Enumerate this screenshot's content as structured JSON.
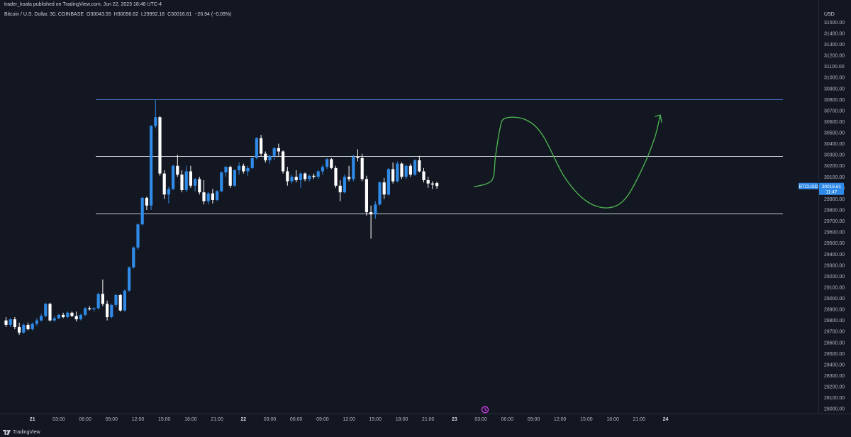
{
  "header": {
    "published": "trader_koala published on TradingView.com, Jun 22, 2023 18:48 UTC-4",
    "symbol_line": "Bitcoin / U.S. Dollar, 30, COINBASE",
    "ohlc": [
      {
        "label": "O",
        "value": "30043.55"
      },
      {
        "label": "H",
        "value": "30056.62"
      },
      {
        "label": "L",
        "value": "29992.18"
      },
      {
        "label": "C",
        "value": "30016.61"
      }
    ],
    "change": "−26.94 (−0.09%)"
  },
  "footer": {
    "brand": "TradingView",
    "logo_icon": "tradingview-logo-icon"
  },
  "colors": {
    "background": "#131722",
    "up": "#2962ff",
    "up_light": "#2f8ae8",
    "down": "#ffffff",
    "level_line": "#c9ccd4",
    "top_line": "#4a76c7",
    "projection": "#4caf50",
    "price_tag": "#2f8ae8",
    "axis_text": "#b2b5be"
  },
  "chart_data": {
    "type": "candlestick",
    "symbol": "BTCUSD",
    "interval": "30",
    "exchange": "COINBASE",
    "price_axis": {
      "currency": "USD",
      "ylim": [
        27950,
        31650
      ],
      "ticks": [
        28000,
        28100,
        28200,
        28300,
        28400,
        28500,
        28600,
        28700,
        28800,
        28900,
        29000,
        29100,
        29200,
        29300,
        29400,
        29500,
        29600,
        29700,
        29800,
        29900,
        30000,
        30100,
        30200,
        30300,
        30400,
        30500,
        30600,
        30700,
        30800,
        30900,
        31000,
        31100,
        31200,
        31300,
        31400,
        31500
      ]
    },
    "time_axis": {
      "labels": [
        "21",
        "03:00",
        "06:00",
        "09:00",
        "12:00",
        "15:00",
        "18:00",
        "21:00",
        "22",
        "03:00",
        "06:00",
        "09:00",
        "12:00",
        "15:00",
        "18:00",
        "21:00",
        "23",
        "03:00",
        "06:00",
        "09:00",
        "12:00",
        "15:00",
        "18:00",
        "21:00",
        "24"
      ],
      "bold": [
        "21",
        "22",
        "23",
        "24"
      ],
      "bars_per_label": 6
    },
    "last_price": {
      "symbol": "BTCUSD",
      "value": "30016.61",
      "countdown": "11:47"
    },
    "horizontal_levels": [
      {
        "price": 30800,
        "style": "blue"
      },
      {
        "price": 30290,
        "style": "light"
      },
      {
        "price": 29770,
        "style": "light"
      }
    ],
    "projection_path": [
      {
        "bar": 106.5,
        "price": 30010
      },
      {
        "bar": 110.5,
        "price": 30070
      },
      {
        "bar": 111.3,
        "price": 30280
      },
      {
        "bar": 112.3,
        "price": 30530
      },
      {
        "bar": 113.5,
        "price": 30630
      },
      {
        "bar": 118,
        "price": 30620
      },
      {
        "bar": 122,
        "price": 30480
      },
      {
        "bar": 127,
        "price": 30100
      },
      {
        "bar": 132,
        "price": 29880
      },
      {
        "bar": 137,
        "price": 29820
      },
      {
        "bar": 141,
        "price": 29910
      },
      {
        "bar": 145,
        "price": 30200
      },
      {
        "bar": 147.5,
        "price": 30450
      },
      {
        "bar": 148.8,
        "price": 30660
      }
    ],
    "candles": [
      {
        "o": 28800,
        "h": 28830,
        "l": 28740,
        "c": 28760
      },
      {
        "o": 28760,
        "h": 28820,
        "l": 28740,
        "c": 28810
      },
      {
        "o": 28810,
        "h": 28830,
        "l": 28720,
        "c": 28740
      },
      {
        "o": 28740,
        "h": 28780,
        "l": 28670,
        "c": 28690
      },
      {
        "o": 28690,
        "h": 28770,
        "l": 28680,
        "c": 28760
      },
      {
        "o": 28760,
        "h": 28780,
        "l": 28710,
        "c": 28720
      },
      {
        "o": 28720,
        "h": 28780,
        "l": 28710,
        "c": 28770
      },
      {
        "o": 28770,
        "h": 28820,
        "l": 28750,
        "c": 28800
      },
      {
        "o": 28800,
        "h": 28860,
        "l": 28790,
        "c": 28840
      },
      {
        "o": 28840,
        "h": 28960,
        "l": 28830,
        "c": 28950
      },
      {
        "o": 28950,
        "h": 28960,
        "l": 28790,
        "c": 28800
      },
      {
        "o": 28800,
        "h": 28840,
        "l": 28790,
        "c": 28820
      },
      {
        "o": 28820,
        "h": 28860,
        "l": 28810,
        "c": 28850
      },
      {
        "o": 28850,
        "h": 28870,
        "l": 28820,
        "c": 28830
      },
      {
        "o": 28830,
        "h": 28880,
        "l": 28820,
        "c": 28870
      },
      {
        "o": 28870,
        "h": 28880,
        "l": 28830,
        "c": 28840
      },
      {
        "o": 28840,
        "h": 28880,
        "l": 28790,
        "c": 28810
      },
      {
        "o": 28810,
        "h": 28860,
        "l": 28800,
        "c": 28850
      },
      {
        "o": 28850,
        "h": 28920,
        "l": 28840,
        "c": 28910
      },
      {
        "o": 28910,
        "h": 28930,
        "l": 28890,
        "c": 28900
      },
      {
        "o": 28900,
        "h": 28920,
        "l": 28880,
        "c": 28910
      },
      {
        "o": 28910,
        "h": 29050,
        "l": 28900,
        "c": 29040
      },
      {
        "o": 29040,
        "h": 29170,
        "l": 28930,
        "c": 28950
      },
      {
        "o": 28950,
        "h": 28980,
        "l": 28800,
        "c": 28830
      },
      {
        "o": 28830,
        "h": 28950,
        "l": 28820,
        "c": 28940
      },
      {
        "o": 28940,
        "h": 29040,
        "l": 28920,
        "c": 29030
      },
      {
        "o": 29030,
        "h": 29040,
        "l": 28880,
        "c": 28890
      },
      {
        "o": 28890,
        "h": 29080,
        "l": 28880,
        "c": 29070
      },
      {
        "o": 29070,
        "h": 29290,
        "l": 29060,
        "c": 29280
      },
      {
        "o": 29280,
        "h": 29470,
        "l": 29270,
        "c": 29460
      },
      {
        "o": 29460,
        "h": 29680,
        "l": 29440,
        "c": 29670
      },
      {
        "o": 29670,
        "h": 29920,
        "l": 29660,
        "c": 29910
      },
      {
        "o": 29910,
        "h": 29920,
        "l": 29800,
        "c": 29840
      },
      {
        "o": 29840,
        "h": 30570,
        "l": 29800,
        "c": 30560
      },
      {
        "o": 30560,
        "h": 30800,
        "l": 30540,
        "c": 30640
      },
      {
        "o": 30640,
        "h": 30650,
        "l": 30110,
        "c": 30130
      },
      {
        "o": 30130,
        "h": 30160,
        "l": 29900,
        "c": 29940
      },
      {
        "o": 29940,
        "h": 30010,
        "l": 29860,
        "c": 29990
      },
      {
        "o": 29990,
        "h": 30210,
        "l": 29980,
        "c": 30200
      },
      {
        "o": 30200,
        "h": 30300,
        "l": 30100,
        "c": 30120
      },
      {
        "o": 30120,
        "h": 30160,
        "l": 29960,
        "c": 29980
      },
      {
        "o": 29980,
        "h": 30200,
        "l": 29960,
        "c": 30150
      },
      {
        "o": 30150,
        "h": 30200,
        "l": 30000,
        "c": 30020
      },
      {
        "o": 30020,
        "h": 30090,
        "l": 29970,
        "c": 30080
      },
      {
        "o": 30080,
        "h": 30100,
        "l": 29940,
        "c": 29960
      },
      {
        "o": 29960,
        "h": 30070,
        "l": 29850,
        "c": 29880
      },
      {
        "o": 29880,
        "h": 29960,
        "l": 29850,
        "c": 29950
      },
      {
        "o": 29950,
        "h": 29990,
        "l": 29860,
        "c": 29890
      },
      {
        "o": 29890,
        "h": 29980,
        "l": 29880,
        "c": 29970
      },
      {
        "o": 29970,
        "h": 30150,
        "l": 29960,
        "c": 30140
      },
      {
        "o": 30140,
        "h": 30200,
        "l": 30100,
        "c": 30190
      },
      {
        "o": 30190,
        "h": 30200,
        "l": 30000,
        "c": 30020
      },
      {
        "o": 30020,
        "h": 30170,
        "l": 30010,
        "c": 30160
      },
      {
        "o": 30160,
        "h": 30230,
        "l": 30120,
        "c": 30200
      },
      {
        "o": 30200,
        "h": 30220,
        "l": 30130,
        "c": 30150
      },
      {
        "o": 30150,
        "h": 30200,
        "l": 30110,
        "c": 30180
      },
      {
        "o": 30180,
        "h": 30280,
        "l": 30170,
        "c": 30270
      },
      {
        "o": 30270,
        "h": 30460,
        "l": 30260,
        "c": 30450
      },
      {
        "o": 30450,
        "h": 30480,
        "l": 30290,
        "c": 30310
      },
      {
        "o": 30310,
        "h": 30330,
        "l": 30230,
        "c": 30250
      },
      {
        "o": 30250,
        "h": 30300,
        "l": 30220,
        "c": 30290
      },
      {
        "o": 30290,
        "h": 30370,
        "l": 30250,
        "c": 30360
      },
      {
        "o": 30360,
        "h": 30400,
        "l": 30290,
        "c": 30330
      },
      {
        "o": 30330,
        "h": 30340,
        "l": 30130,
        "c": 30150
      },
      {
        "o": 30150,
        "h": 30190,
        "l": 30020,
        "c": 30060
      },
      {
        "o": 30060,
        "h": 30120,
        "l": 30040,
        "c": 30100
      },
      {
        "o": 30100,
        "h": 30160,
        "l": 30050,
        "c": 30070
      },
      {
        "o": 30070,
        "h": 30140,
        "l": 30000,
        "c": 30130
      },
      {
        "o": 30130,
        "h": 30140,
        "l": 30060,
        "c": 30080
      },
      {
        "o": 30080,
        "h": 30120,
        "l": 30060,
        "c": 30110
      },
      {
        "o": 30110,
        "h": 30130,
        "l": 30080,
        "c": 30100
      },
      {
        "o": 30100,
        "h": 30160,
        "l": 30080,
        "c": 30150
      },
      {
        "o": 30150,
        "h": 30210,
        "l": 30120,
        "c": 30190
      },
      {
        "o": 30190,
        "h": 30270,
        "l": 30170,
        "c": 30260
      },
      {
        "o": 30260,
        "h": 30270,
        "l": 30170,
        "c": 30180
      },
      {
        "o": 30180,
        "h": 30200,
        "l": 30000,
        "c": 30020
      },
      {
        "o": 30020,
        "h": 30070,
        "l": 29880,
        "c": 29960
      },
      {
        "o": 29960,
        "h": 30120,
        "l": 29950,
        "c": 30100
      },
      {
        "o": 30100,
        "h": 30200,
        "l": 30060,
        "c": 30080
      },
      {
        "o": 30080,
        "h": 30300,
        "l": 30060,
        "c": 30280
      },
      {
        "o": 30280,
        "h": 30350,
        "l": 30240,
        "c": 30270
      },
      {
        "o": 30270,
        "h": 30310,
        "l": 30060,
        "c": 30080
      },
      {
        "o": 30080,
        "h": 30110,
        "l": 29750,
        "c": 29780
      },
      {
        "o": 29780,
        "h": 29840,
        "l": 29540,
        "c": 29760
      },
      {
        "o": 29760,
        "h": 29880,
        "l": 29720,
        "c": 29850
      },
      {
        "o": 29850,
        "h": 30060,
        "l": 29840,
        "c": 30050
      },
      {
        "o": 30050,
        "h": 30090,
        "l": 29900,
        "c": 29940
      },
      {
        "o": 29940,
        "h": 30180,
        "l": 29930,
        "c": 30170
      },
      {
        "o": 30170,
        "h": 30230,
        "l": 30040,
        "c": 30060
      },
      {
        "o": 30060,
        "h": 30240,
        "l": 30050,
        "c": 30220
      },
      {
        "o": 30220,
        "h": 30230,
        "l": 30080,
        "c": 30100
      },
      {
        "o": 30100,
        "h": 30210,
        "l": 30080,
        "c": 30200
      },
      {
        "o": 30200,
        "h": 30220,
        "l": 30100,
        "c": 30120
      },
      {
        "o": 30120,
        "h": 30260,
        "l": 30110,
        "c": 30250
      },
      {
        "o": 30250,
        "h": 30290,
        "l": 30140,
        "c": 30150
      },
      {
        "o": 30150,
        "h": 30180,
        "l": 30050,
        "c": 30070
      },
      {
        "o": 30070,
        "h": 30100,
        "l": 30000,
        "c": 30040
      },
      {
        "o": 30040,
        "h": 30060,
        "l": 29990,
        "c": 30030
      },
      {
        "o": 30043.55,
        "h": 30056.62,
        "l": 29992.18,
        "c": 30016.61
      }
    ]
  }
}
